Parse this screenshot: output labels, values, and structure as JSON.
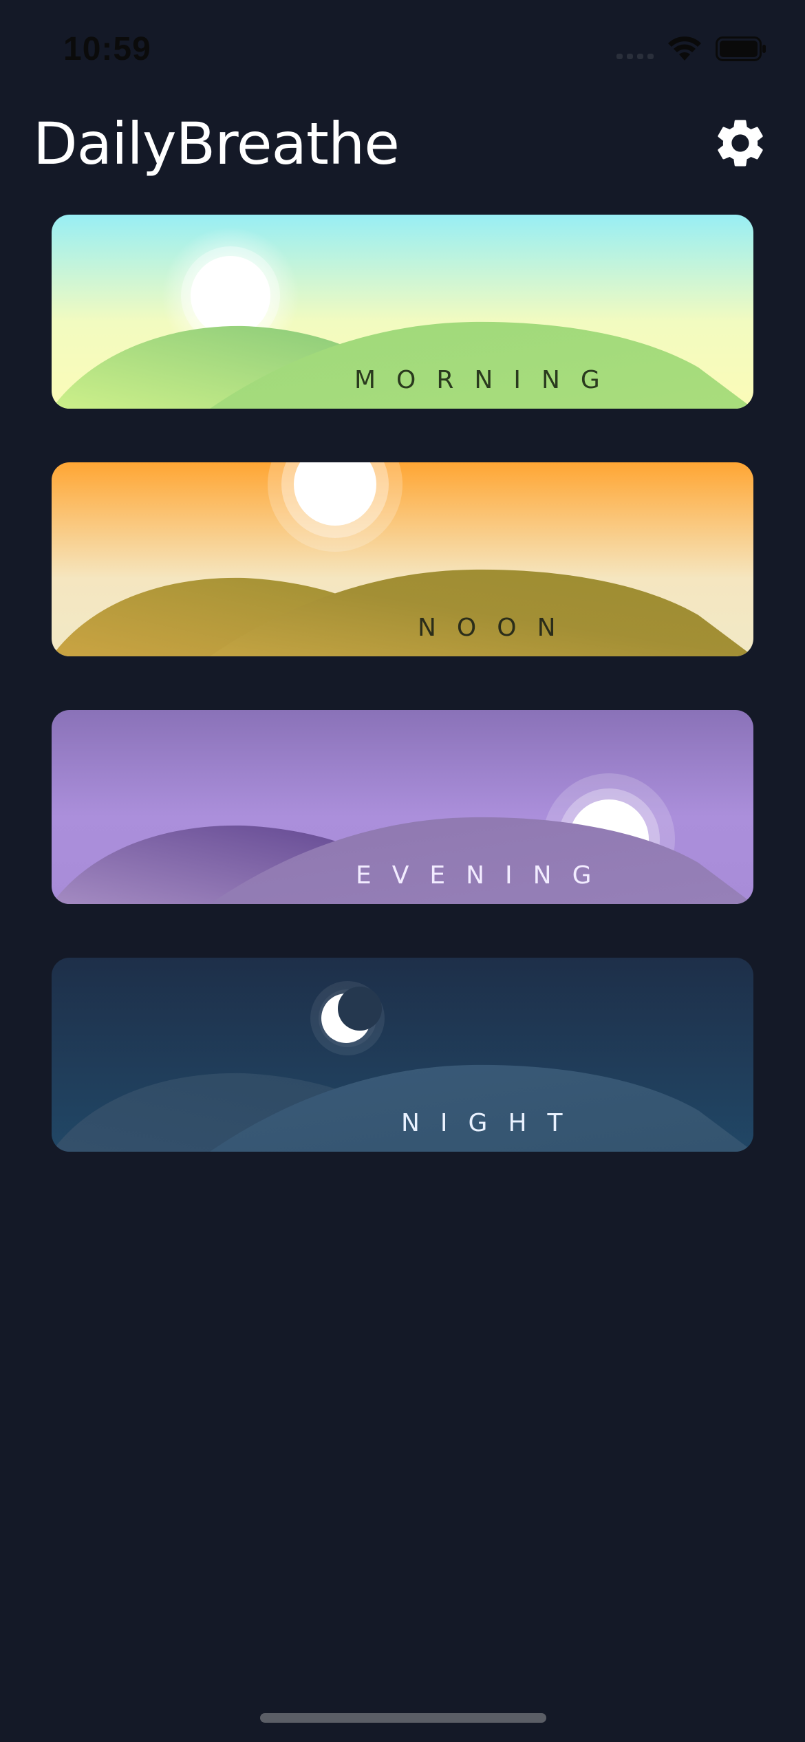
{
  "status_bar": {
    "time": "10:59",
    "icons": [
      "signal-icon",
      "wifi-icon",
      "battery-icon"
    ]
  },
  "header": {
    "title": "DailyBreathe",
    "settings_icon": "gear-icon"
  },
  "cards": [
    {
      "label": "MORNING",
      "label_color": "#2a3a1e",
      "icon": "sun-icon"
    },
    {
      "label": "NOON",
      "label_color": "#2b2d1a",
      "icon": "sun-icon"
    },
    {
      "label": "EVENING",
      "label_color": "#f2ecff",
      "icon": "sun-icon"
    },
    {
      "label": "NIGHT",
      "label_color": "#eaf2ff",
      "icon": "moon-icon"
    }
  ],
  "colors": {
    "background": "#141927",
    "text": "#ffffff"
  }
}
